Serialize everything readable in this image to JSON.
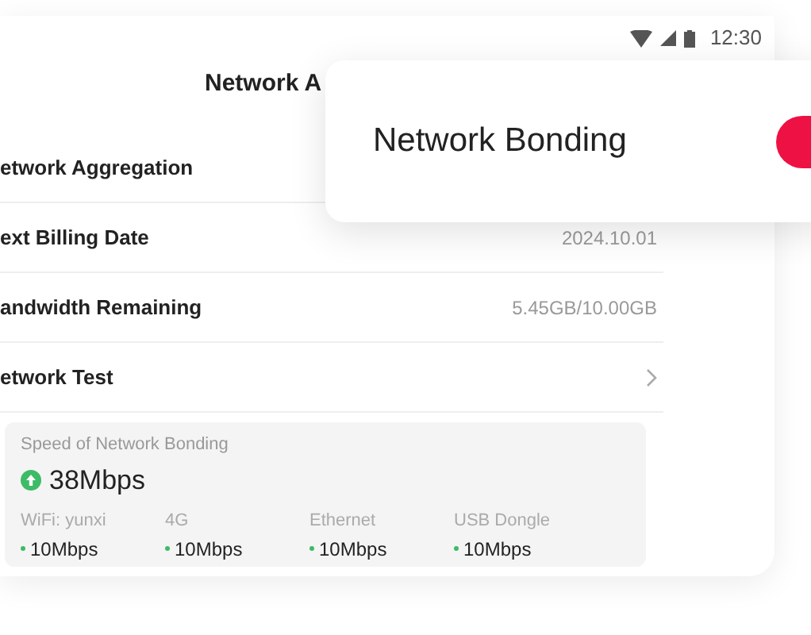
{
  "status_bar": {
    "time": "12:30"
  },
  "page": {
    "title": "Network A"
  },
  "rows": [
    {
      "label": "etwork Aggregation",
      "kind": "plain"
    },
    {
      "label": "ext Billing Date",
      "value": "2024.10.01",
      "kind": "value"
    },
    {
      "label": "andwidth Remaining",
      "value": "5.45GB/10.00GB",
      "kind": "value"
    },
    {
      "label": "etwork Test",
      "kind": "link"
    }
  ],
  "speed_panel": {
    "label": "Speed of Network Bonding",
    "total": "38Mbps",
    "links": [
      {
        "name": "WiFi: yunxi",
        "speed": "10Mbps"
      },
      {
        "name": "4G",
        "speed": "10Mbps"
      },
      {
        "name": "Ethernet",
        "speed": "10Mbps"
      },
      {
        "name": "USB Dongle",
        "speed": "10Mbps"
      }
    ]
  },
  "bonding_card": {
    "title": "Network Bonding",
    "toggle": {
      "on": true
    }
  }
}
